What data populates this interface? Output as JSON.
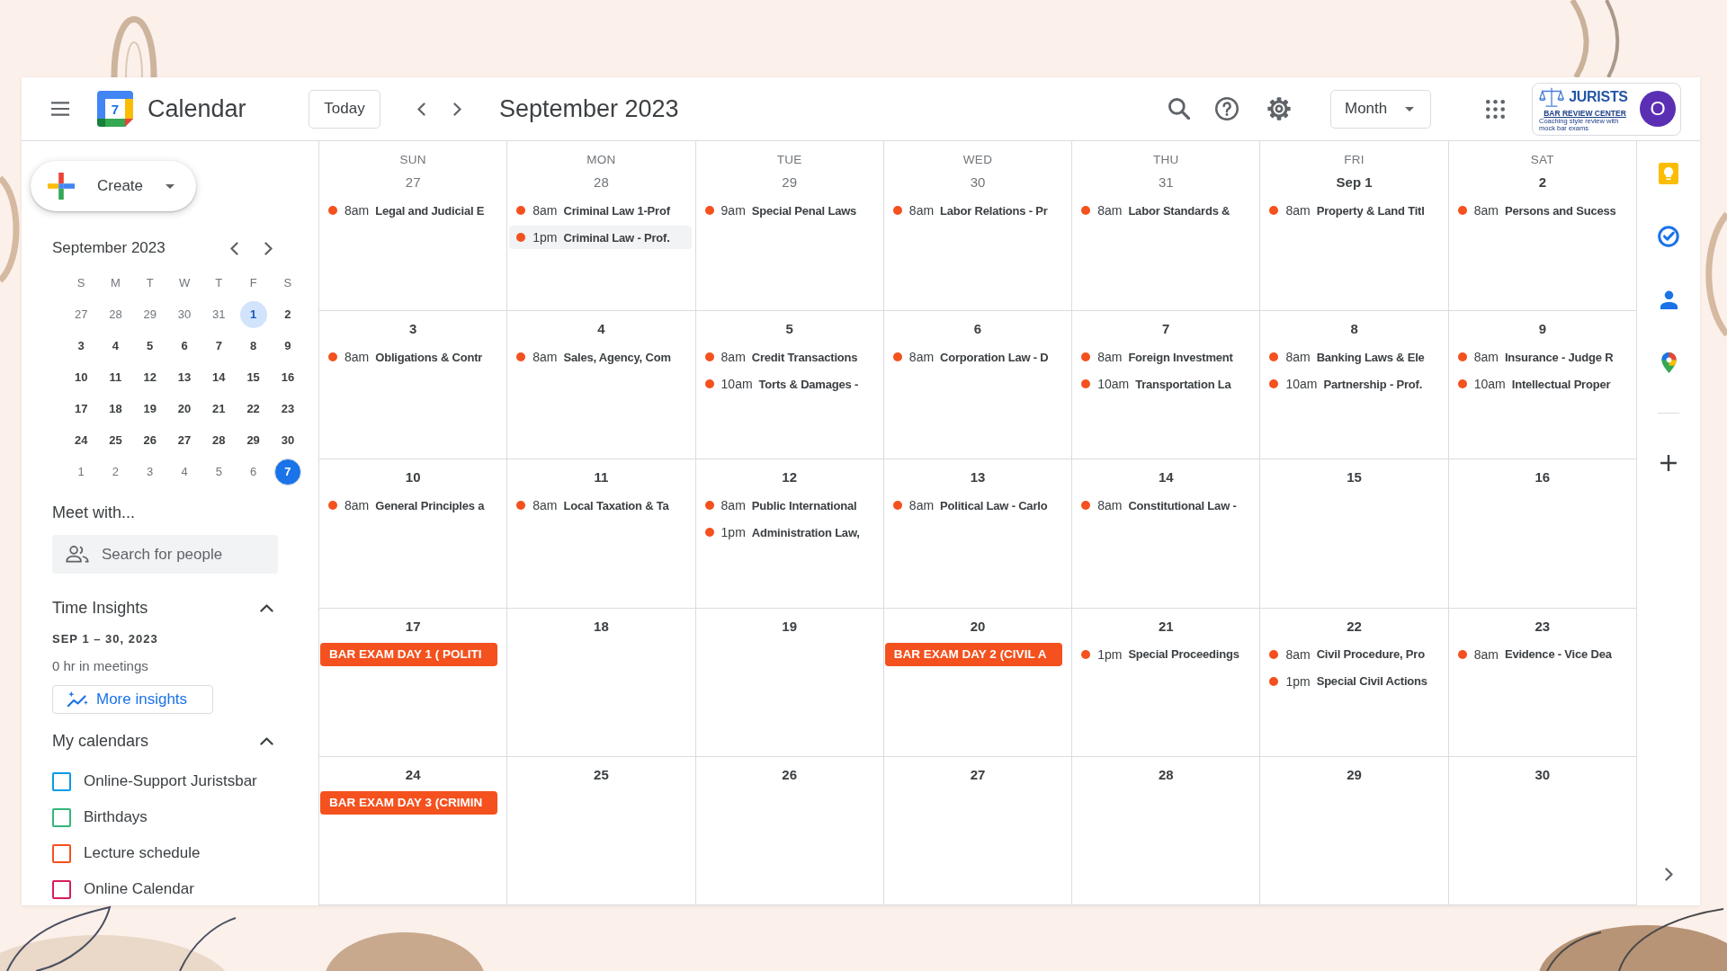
{
  "header": {
    "app_name": "Calendar",
    "logo_day": "7",
    "today_button": "Today",
    "period_title": "September 2023",
    "view_selector": "Month",
    "account": {
      "org_name": "JURISTS",
      "org_subtitle": "BAR REVIEW CENTER",
      "org_tagline": "Coaching style review with mock bar exams",
      "avatar_initial": "O"
    }
  },
  "sidebar": {
    "create_button": "Create",
    "mini_calendar": {
      "title": "September 2023",
      "weekdays": [
        "S",
        "M",
        "T",
        "W",
        "T",
        "F",
        "S"
      ],
      "weeks": [
        [
          {
            "day": "27",
            "outside": true,
            "selected": false,
            "today": false
          },
          {
            "day": "28",
            "outside": true,
            "selected": false,
            "today": false
          },
          {
            "day": "29",
            "outside": true,
            "selected": false,
            "today": false
          },
          {
            "day": "30",
            "outside": true,
            "selected": false,
            "today": false
          },
          {
            "day": "31",
            "outside": true,
            "selected": false,
            "today": false
          },
          {
            "day": "1",
            "outside": false,
            "selected": true,
            "today": false
          },
          {
            "day": "2",
            "outside": false,
            "selected": false,
            "today": false
          }
        ],
        [
          {
            "day": "3",
            "outside": false,
            "selected": false,
            "today": false
          },
          {
            "day": "4",
            "outside": false,
            "selected": false,
            "today": false
          },
          {
            "day": "5",
            "outside": false,
            "selected": false,
            "today": false
          },
          {
            "day": "6",
            "outside": false,
            "selected": false,
            "today": false
          },
          {
            "day": "7",
            "outside": false,
            "selected": false,
            "today": false
          },
          {
            "day": "8",
            "outside": false,
            "selected": false,
            "today": false
          },
          {
            "day": "9",
            "outside": false,
            "selected": false,
            "today": false
          }
        ],
        [
          {
            "day": "10",
            "outside": false,
            "selected": false,
            "today": false
          },
          {
            "day": "11",
            "outside": false,
            "selected": false,
            "today": false
          },
          {
            "day": "12",
            "outside": false,
            "selected": false,
            "today": false
          },
          {
            "day": "13",
            "outside": false,
            "selected": false,
            "today": false
          },
          {
            "day": "14",
            "outside": false,
            "selected": false,
            "today": false
          },
          {
            "day": "15",
            "outside": false,
            "selected": false,
            "today": false
          },
          {
            "day": "16",
            "outside": false,
            "selected": false,
            "today": false
          }
        ],
        [
          {
            "day": "17",
            "outside": false,
            "selected": false,
            "today": false
          },
          {
            "day": "18",
            "outside": false,
            "selected": false,
            "today": false
          },
          {
            "day": "19",
            "outside": false,
            "selected": false,
            "today": false
          },
          {
            "day": "20",
            "outside": false,
            "selected": false,
            "today": false
          },
          {
            "day": "21",
            "outside": false,
            "selected": false,
            "today": false
          },
          {
            "day": "22",
            "outside": false,
            "selected": false,
            "today": false
          },
          {
            "day": "23",
            "outside": false,
            "selected": false,
            "today": false
          }
        ],
        [
          {
            "day": "24",
            "outside": false,
            "selected": false,
            "today": false
          },
          {
            "day": "25",
            "outside": false,
            "selected": false,
            "today": false
          },
          {
            "day": "26",
            "outside": false,
            "selected": false,
            "today": false
          },
          {
            "day": "27",
            "outside": false,
            "selected": false,
            "today": false
          },
          {
            "day": "28",
            "outside": false,
            "selected": false,
            "today": false
          },
          {
            "day": "29",
            "outside": false,
            "selected": false,
            "today": false
          },
          {
            "day": "30",
            "outside": false,
            "selected": false,
            "today": false
          }
        ],
        [
          {
            "day": "1",
            "outside": true,
            "selected": false,
            "today": false
          },
          {
            "day": "2",
            "outside": true,
            "selected": false,
            "today": false
          },
          {
            "day": "3",
            "outside": true,
            "selected": false,
            "today": false
          },
          {
            "day": "4",
            "outside": true,
            "selected": false,
            "today": false
          },
          {
            "day": "5",
            "outside": true,
            "selected": false,
            "today": false
          },
          {
            "day": "6",
            "outside": true,
            "selected": false,
            "today": false
          },
          {
            "day": "7",
            "outside": true,
            "selected": false,
            "today": true
          }
        ]
      ]
    },
    "meet_with": {
      "heading": "Meet with...",
      "search": {
        "placeholder": "Search for people"
      }
    },
    "time_insights": {
      "heading": "Time Insights",
      "expanded": true,
      "date_range": "SEP 1 – 30, 2023",
      "summary": "0 hr in meetings",
      "button": "More insights"
    },
    "my_calendars": {
      "heading": "My calendars",
      "expanded": true,
      "items": [
        {
          "name": "Online-Support Juristsbar",
          "checked": false,
          "color": "#039be5"
        },
        {
          "name": "Birthdays",
          "checked": false,
          "color": "#33b679"
        },
        {
          "name": "Lecture schedule",
          "checked": false,
          "color": "#f4511e"
        },
        {
          "name": "Online Calendar",
          "checked": false,
          "color": "#d81b60"
        }
      ]
    }
  },
  "month_grid": {
    "weekdays": [
      "SUN",
      "MON",
      "TUE",
      "WED",
      "THU",
      "FRI",
      "SAT"
    ],
    "weeks": [
      {
        "days": [
          {
            "date": "27",
            "outside": true,
            "events": [
              {
                "kind": "timed",
                "time": "8am",
                "title": "Legal and Judicial E",
                "selected": false
              }
            ]
          },
          {
            "date": "28",
            "outside": true,
            "events": [
              {
                "kind": "timed",
                "time": "8am",
                "title": "Criminal Law 1-Prof",
                "selected": false
              },
              {
                "kind": "timed",
                "time": "1pm",
                "title": "Criminal Law - Prof.",
                "selected": true
              }
            ]
          },
          {
            "date": "29",
            "outside": true,
            "events": [
              {
                "kind": "timed",
                "time": "9am",
                "title": "Special Penal Laws",
                "selected": false
              }
            ]
          },
          {
            "date": "30",
            "outside": true,
            "events": [
              {
                "kind": "timed",
                "time": "8am",
                "title": "Labor Relations - Pr",
                "selected": false
              }
            ]
          },
          {
            "date": "31",
            "outside": true,
            "events": [
              {
                "kind": "timed",
                "time": "8am",
                "title": "Labor Standards &",
                "selected": false
              }
            ]
          },
          {
            "date": "Sep 1",
            "outside": false,
            "events": [
              {
                "kind": "timed",
                "time": "8am",
                "title": "Property & Land Titl",
                "selected": false
              }
            ]
          },
          {
            "date": "2",
            "outside": false,
            "events": [
              {
                "kind": "timed",
                "time": "8am",
                "title": "Persons and Sucess",
                "selected": false
              }
            ]
          }
        ]
      },
      {
        "days": [
          {
            "date": "3",
            "outside": false,
            "events": [
              {
                "kind": "timed",
                "time": "8am",
                "title": "Obligations & Contr",
                "selected": false
              }
            ]
          },
          {
            "date": "4",
            "outside": false,
            "events": [
              {
                "kind": "timed",
                "time": "8am",
                "title": "Sales, Agency, Com",
                "selected": false
              }
            ]
          },
          {
            "date": "5",
            "outside": false,
            "events": [
              {
                "kind": "timed",
                "time": "8am",
                "title": "Credit Transactions",
                "selected": false
              },
              {
                "kind": "timed",
                "time": "10am",
                "title": "Torts & Damages -",
                "selected": false
              }
            ]
          },
          {
            "date": "6",
            "outside": false,
            "events": [
              {
                "kind": "timed",
                "time": "8am",
                "title": "Corporation Law - D",
                "selected": false
              }
            ]
          },
          {
            "date": "7",
            "outside": false,
            "events": [
              {
                "kind": "timed",
                "time": "8am",
                "title": "Foreign Investment",
                "selected": false
              },
              {
                "kind": "timed",
                "time": "10am",
                "title": "Transportation La",
                "selected": false
              }
            ]
          },
          {
            "date": "8",
            "outside": false,
            "events": [
              {
                "kind": "timed",
                "time": "8am",
                "title": "Banking Laws & Ele",
                "selected": false
              },
              {
                "kind": "timed",
                "time": "10am",
                "title": "Partnership - Prof.",
                "selected": false
              }
            ]
          },
          {
            "date": "9",
            "outside": false,
            "events": [
              {
                "kind": "timed",
                "time": "8am",
                "title": "Insurance - Judge R",
                "selected": false
              },
              {
                "kind": "timed",
                "time": "10am",
                "title": "Intellectual Proper",
                "selected": false
              }
            ]
          }
        ]
      },
      {
        "days": [
          {
            "date": "10",
            "outside": false,
            "events": [
              {
                "kind": "timed",
                "time": "8am",
                "title": "General Principles a",
                "selected": false
              }
            ]
          },
          {
            "date": "11",
            "outside": false,
            "events": [
              {
                "kind": "timed",
                "time": "8am",
                "title": "Local Taxation & Ta",
                "selected": false
              }
            ]
          },
          {
            "date": "12",
            "outside": false,
            "events": [
              {
                "kind": "timed",
                "time": "8am",
                "title": "Public International",
                "selected": false
              },
              {
                "kind": "timed",
                "time": "1pm",
                "title": "Administration Law,",
                "selected": false
              }
            ]
          },
          {
            "date": "13",
            "outside": false,
            "events": [
              {
                "kind": "timed",
                "time": "8am",
                "title": "Political Law - Carlo",
                "selected": false
              }
            ]
          },
          {
            "date": "14",
            "outside": false,
            "events": [
              {
                "kind": "timed",
                "time": "8am",
                "title": "Constitutional Law -",
                "selected": false
              }
            ]
          },
          {
            "date": "15",
            "outside": false
          },
          {
            "date": "16",
            "outside": false
          }
        ]
      },
      {
        "days": [
          {
            "date": "17",
            "outside": false,
            "events": [
              {
                "kind": "allday",
                "title": "BAR EXAM DAY 1 ( POLITI",
                "selected": false
              }
            ]
          },
          {
            "date": "18",
            "outside": false
          },
          {
            "date": "19",
            "outside": false
          },
          {
            "date": "20",
            "outside": false,
            "events": [
              {
                "kind": "allday",
                "title": "BAR EXAM DAY 2 (CIVIL A",
                "selected": false
              }
            ]
          },
          {
            "date": "21",
            "outside": false,
            "events": [
              {
                "kind": "timed",
                "time": "1pm",
                "title": "Special Proceedings",
                "selected": false
              }
            ]
          },
          {
            "date": "22",
            "outside": false,
            "events": [
              {
                "kind": "timed",
                "time": "8am",
                "title": "Civil Procedure, Pro",
                "selected": false
              },
              {
                "kind": "timed",
                "time": "1pm",
                "title": "Special Civil Actions",
                "selected": false
              }
            ]
          },
          {
            "date": "23",
            "outside": false,
            "events": [
              {
                "kind": "timed",
                "time": "8am",
                "title": "Evidence - Vice Dea",
                "selected": false
              }
            ]
          }
        ]
      },
      {
        "days": [
          {
            "date": "24",
            "outside": false,
            "events": [
              {
                "kind": "allday",
                "title": "BAR EXAM DAY 3 (CRIMIN",
                "selected": false
              }
            ]
          },
          {
            "date": "25",
            "outside": false
          },
          {
            "date": "26",
            "outside": false
          },
          {
            "date": "27",
            "outside": false
          },
          {
            "date": "28",
            "outside": false
          },
          {
            "date": "29",
            "outside": false
          },
          {
            "date": "30",
            "outside": false
          }
        ]
      }
    ]
  }
}
